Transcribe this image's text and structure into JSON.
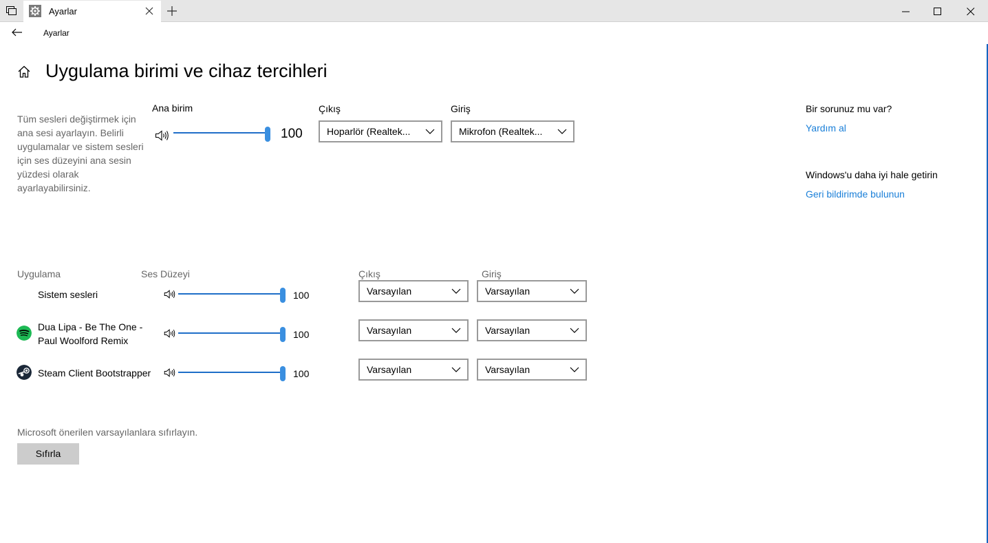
{
  "window": {
    "tab_title": "Ayarlar",
    "nav_title": "Ayarlar"
  },
  "page": {
    "title": "Uygulama birimi ve cihaz tercihleri",
    "description": "Tüm sesleri değiştirmek için ana sesi ayarlayın. Belirli uygulamalar ve sistem sesleri için ses düzeyini ana sesin yüzdesi olarak ayarlayabilirsiniz."
  },
  "master": {
    "label": "Ana birim",
    "value": 100,
    "value_text": "100",
    "output_label": "Çıkış",
    "output_value": "Hoparlör (Realtek...",
    "input_label": "Giriş",
    "input_value": "Mikrofon (Realtek..."
  },
  "apps_table": {
    "col_app": "Uygulama",
    "col_volume": "Ses Düzeyi",
    "col_output": "Çıkış",
    "col_input": "Giriş",
    "rows": [
      {
        "name": "Sistem sesleri",
        "icon": "none",
        "volume": 100,
        "volume_text": "100",
        "output": "Varsayılan",
        "input": "Varsayılan"
      },
      {
        "name": "Dua Lipa - Be The One - Paul Woolford Remix",
        "name_line1": "Dua Lipa - Be The One -",
        "name_line2": "Paul Woolford Remix",
        "icon": "spotify-icon",
        "volume": 100,
        "volume_text": "100",
        "output": "Varsayılan",
        "input": "Varsayılan"
      },
      {
        "name": "Steam Client Bootstrapper",
        "icon": "steam-icon",
        "volume": 100,
        "volume_text": "100",
        "output": "Varsayılan",
        "input": "Varsayılan"
      }
    ]
  },
  "reset": {
    "description": "Microsoft önerilen varsayılanlara sıfırlayın.",
    "button_label": "Sıfırla"
  },
  "help": {
    "question": "Bir sorunuz mu var?",
    "help_link": "Yardım al",
    "improve": "Windows'u daha iyi hale getirin",
    "feedback_link": "Geri bildirimde bulunun"
  },
  "colors": {
    "accent": "#1a7fd8",
    "slider_thumb": "#3a8fe0",
    "spotify": "#1db954",
    "steam": "#1b2838"
  }
}
